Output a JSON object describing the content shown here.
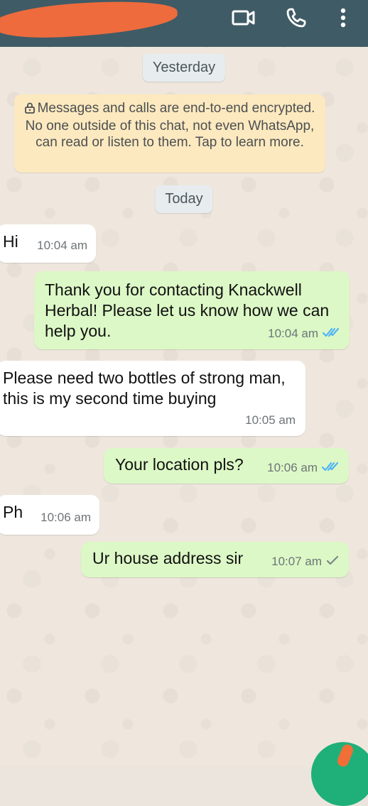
{
  "header": {
    "contact_name_redacted": "",
    "icons": [
      "video-call-icon",
      "voice-call-icon",
      "more-options-icon"
    ]
  },
  "date_chips": {
    "yesterday": "Yesterday",
    "today": "Today"
  },
  "encryption_notice": {
    "text": "Messages and calls are end-to-end encrypted. No one outside of this chat, not even WhatsApp, can read or listen to them. Tap to learn more."
  },
  "messages": [
    {
      "direction": "incoming",
      "text": "Hi",
      "time": "10:04 am"
    },
    {
      "direction": "outgoing",
      "text": "Thank you for contacting Knackwell Herbal! Please let us know how we can help you.",
      "time": "10:04 am",
      "status": "read"
    },
    {
      "direction": "incoming",
      "text": "Please need two bottles of strong man, this is my second time buying",
      "time": "10:05 am"
    },
    {
      "direction": "outgoing",
      "text": "Your location pls?",
      "time": "10:06 am",
      "status": "read"
    },
    {
      "direction": "incoming",
      "text": "Ph",
      "time": "10:06 am"
    },
    {
      "direction": "outgoing",
      "text": "Ur house address sir",
      "time": "10:07 am",
      "status": "sent"
    }
  ],
  "colors": {
    "header": "#3f5b66",
    "incoming_bubble": "#ffffff",
    "outgoing_bubble": "#dcf8c6",
    "read_tick": "#4fb3f6",
    "sent_tick": "#7c8589",
    "encryption_notice": "#fde9bf"
  }
}
